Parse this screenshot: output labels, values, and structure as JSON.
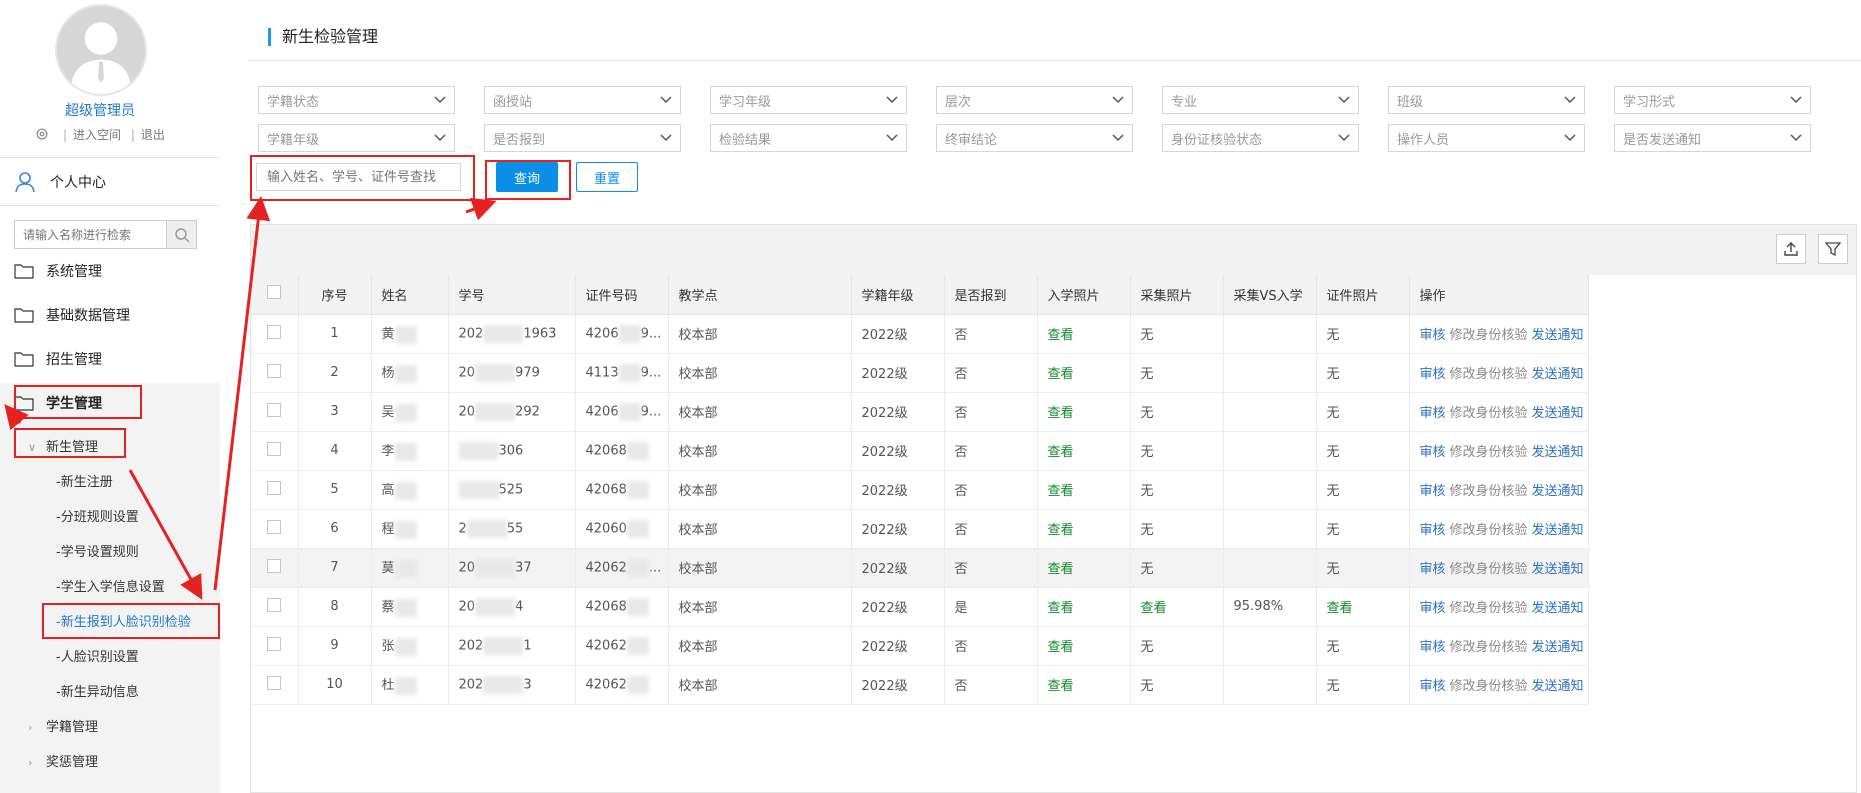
{
  "user": {
    "name": "超级管理员",
    "link_space": "进入空间",
    "link_logout": "退出"
  },
  "sidebar": {
    "personal_center": "个人中心",
    "search_placeholder": "请输入名称进行检索",
    "menus": [
      "系统管理",
      "基础数据管理",
      "招生管理",
      "学生管理"
    ],
    "sub_group": "新生管理",
    "sub_items": [
      "-新生注册",
      "-分班规则设置",
      "-学号设置规则",
      "-学生入学信息设置",
      "-新生报到人脸识别检验",
      "-人脸识别设置",
      "-新生异动信息"
    ],
    "collapsed_groups": [
      "学籍管理",
      "奖惩管理"
    ]
  },
  "page": {
    "title": "新生检验管理"
  },
  "filters": {
    "row1": [
      "学籍状态",
      "函授站",
      "学习年级",
      "层次",
      "专业",
      "班级",
      "学习形式"
    ],
    "row2": [
      "学籍年级",
      "是否报到",
      "检验结果",
      "终审结论",
      "身份证核验状态",
      "操作人员",
      "是否发送通知"
    ]
  },
  "search": {
    "placeholder": "输入姓名、学号、证件号查找",
    "query_label": "查询",
    "reset_label": "重置"
  },
  "table": {
    "columns": [
      "序号",
      "姓名",
      "学号",
      "证件号码",
      "教学点",
      "学籍年级",
      "是否报到",
      "入学照片",
      "采集照片",
      "采集VS入学",
      "证件照片",
      "操作"
    ],
    "rows": [
      {
        "no": "1",
        "name": "黄",
        "sid": "202",
        "sid2": "1963",
        "idno": "4206",
        "idno2": "9...",
        "site": "校本部",
        "grade": "2022级",
        "reported": "否",
        "photo": "查看",
        "collect": "无",
        "vs": "",
        "cert": "无"
      },
      {
        "no": "2",
        "name": "杨",
        "sid": "20",
        "sid2": "979",
        "idno": "4113",
        "idno2": "9...",
        "site": "校本部",
        "grade": "2022级",
        "reported": "否",
        "photo": "查看",
        "collect": "无",
        "vs": "",
        "cert": "无"
      },
      {
        "no": "3",
        "name": "吴",
        "sid": "20",
        "sid2": "292",
        "idno": "4206",
        "idno2": "9...",
        "site": "校本部",
        "grade": "2022级",
        "reported": "否",
        "photo": "查看",
        "collect": "无",
        "vs": "",
        "cert": "无"
      },
      {
        "no": "4",
        "name": "李",
        "sid": "",
        "sid2": "306",
        "idno": "42068",
        "idno2": "",
        "site": "校本部",
        "grade": "2022级",
        "reported": "否",
        "photo": "查看",
        "collect": "无",
        "vs": "",
        "cert": "无"
      },
      {
        "no": "5",
        "name": "高",
        "sid": "",
        "sid2": "525",
        "idno": "42068",
        "idno2": "",
        "site": "校本部",
        "grade": "2022级",
        "reported": "否",
        "photo": "查看",
        "collect": "无",
        "vs": "",
        "cert": "无"
      },
      {
        "no": "6",
        "name": "程",
        "sid": "2",
        "sid2": "55",
        "idno": "42060",
        "idno2": "",
        "site": "校本部",
        "grade": "2022级",
        "reported": "否",
        "photo": "查看",
        "collect": "无",
        "vs": "",
        "cert": "无"
      },
      {
        "no": "7",
        "name": "莫",
        "sid": "20",
        "sid2": "37",
        "idno": "42062",
        "idno2": "...",
        "site": "校本部",
        "grade": "2022级",
        "reported": "否",
        "photo": "查看",
        "collect": "无",
        "vs": "",
        "cert": "无"
      },
      {
        "no": "8",
        "name": "蔡",
        "sid": "20",
        "sid2": "4",
        "idno": "42068",
        "idno2": "",
        "site": "校本部",
        "grade": "2022级",
        "reported": "是",
        "photo": "查看",
        "collect": "查看",
        "vs": "95.98%",
        "cert": "查看"
      },
      {
        "no": "9",
        "name": "张",
        "sid": "202",
        "sid2": "1",
        "idno": "42062",
        "idno2": "",
        "site": "校本部",
        "grade": "2022级",
        "reported": "否",
        "photo": "查看",
        "collect": "无",
        "vs": "",
        "cert": "无"
      },
      {
        "no": "10",
        "name": "杜",
        "sid": "202",
        "sid2": "3",
        "idno": "42062",
        "idno2": "",
        "site": "校本部",
        "grade": "2022级",
        "reported": "否",
        "photo": "查看",
        "collect": "无",
        "vs": "",
        "cert": "无"
      }
    ],
    "ops": {
      "audit": "审核",
      "modify": "修改身份核验",
      "notify": "发送通知"
    }
  },
  "colors": {
    "accent": "#0a8ee8",
    "annotation": "#e52222",
    "green": "#128a2a"
  }
}
